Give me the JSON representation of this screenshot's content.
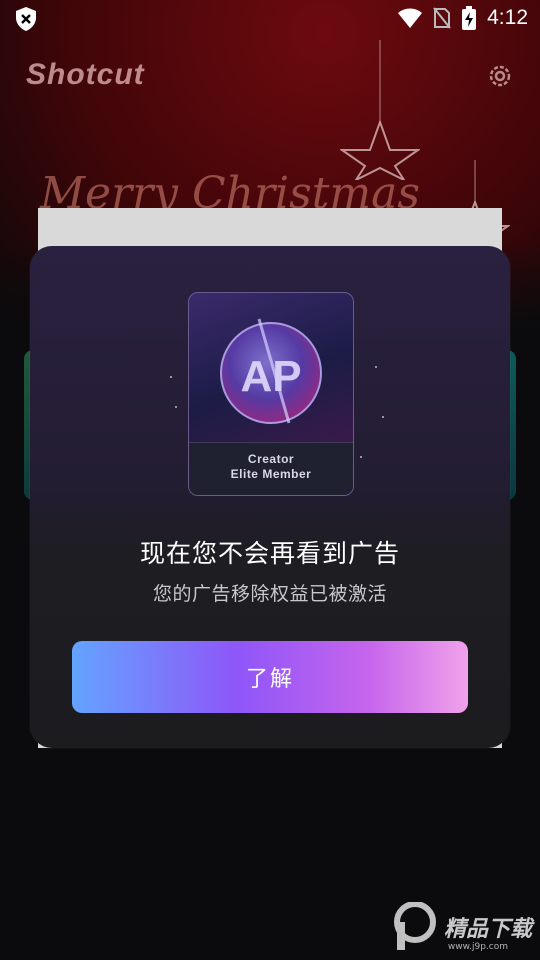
{
  "status_bar": {
    "time": "4:12"
  },
  "app": {
    "logo_text": "Shotcut",
    "banner_text": "Merry Christmas"
  },
  "modal": {
    "card": {
      "line1": "Creator",
      "line2": "Elite Member",
      "emblem_letters": "AP"
    },
    "title": "现在您不会再看到广告",
    "subtitle": "您的广告移除权益已被激活",
    "button_label": "了解"
  },
  "watermark": {
    "brand": "精品下载",
    "url": "www.j9p.com"
  }
}
